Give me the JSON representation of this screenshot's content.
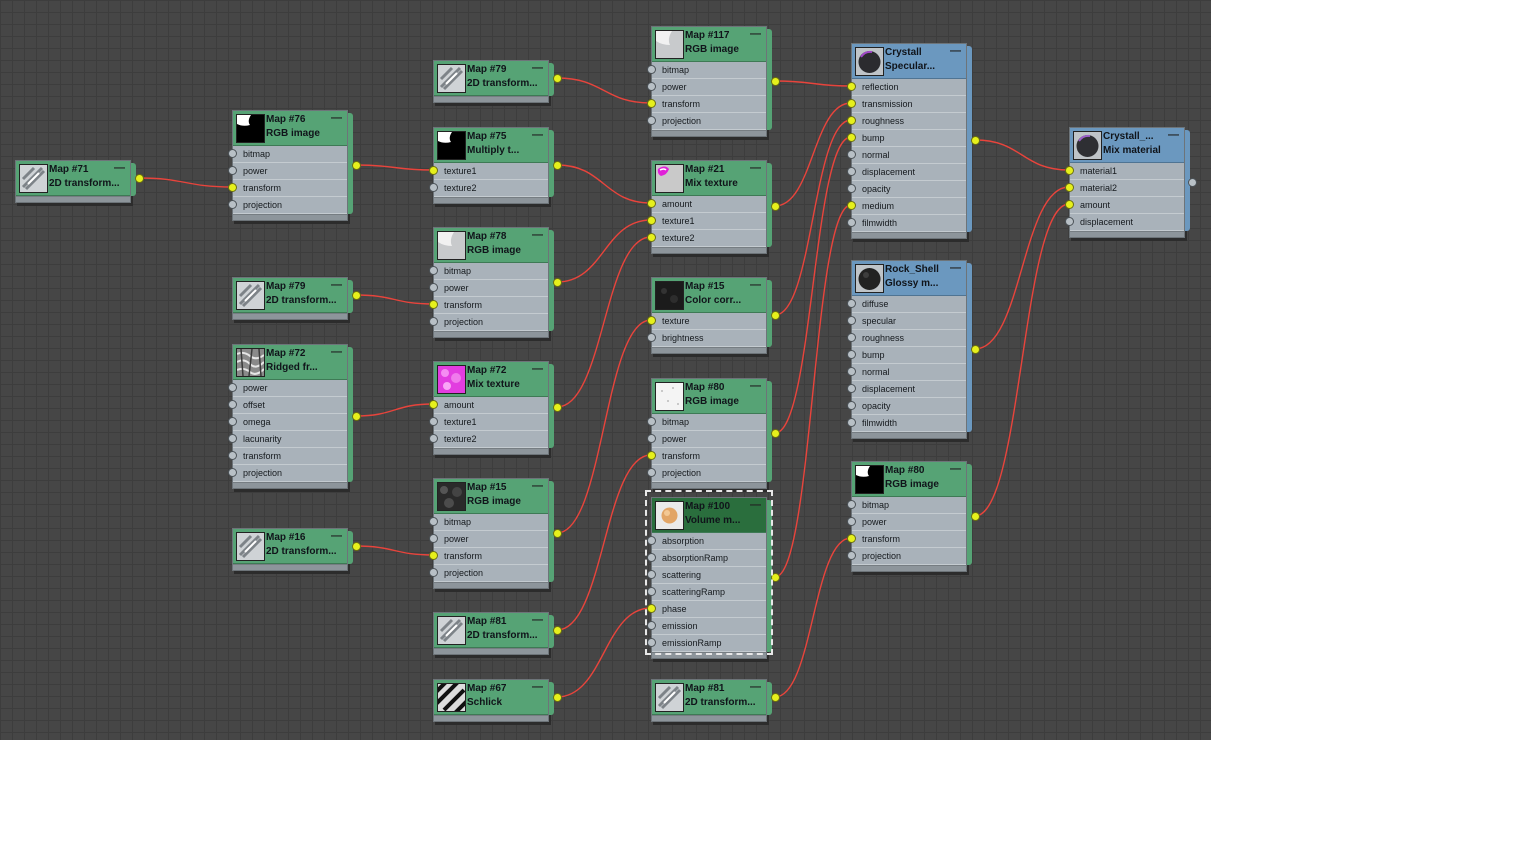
{
  "nodes": [
    {
      "id": "n71",
      "title": "Map #71",
      "subtitle": "2D transform...",
      "thumb": "transform",
      "icon": "transform-thumbnail-icon"
    },
    {
      "id": "n76",
      "title": "Map #76",
      "subtitle": "RGB image",
      "thumb": "black",
      "icon": "rgb-image-thumbnail-icon",
      "ports": [
        {
          "label": "bitmap",
          "on": false
        },
        {
          "label": "power",
          "on": false
        },
        {
          "label": "transform",
          "on": true
        },
        {
          "label": "projection",
          "on": false
        }
      ]
    },
    {
      "id": "n79a",
      "title": "Map #79",
      "subtitle": "2D transform...",
      "thumb": "transform",
      "icon": "transform-thumbnail-icon"
    },
    {
      "id": "n75",
      "title": "Map #75",
      "subtitle": "Multiply  t...",
      "thumb": "black",
      "icon": "multiply-texture-thumbnail-icon",
      "ports": [
        {
          "label": "texture1",
          "on": true
        },
        {
          "label": "texture2",
          "on": false
        }
      ]
    },
    {
      "id": "n117",
      "title": "Map #117",
      "subtitle": "RGB image",
      "thumb": "light",
      "icon": "rgb-image-thumbnail-icon",
      "ports": [
        {
          "label": "bitmap",
          "on": false
        },
        {
          "label": "power",
          "on": false
        },
        {
          "label": "transform",
          "on": true
        },
        {
          "label": "projection",
          "on": false
        }
      ]
    },
    {
      "id": "n21",
      "title": "Map #21",
      "subtitle": "Mix texture",
      "thumb": "magentablob",
      "icon": "mix-texture-thumbnail-icon",
      "ports": [
        {
          "label": "amount",
          "on": true
        },
        {
          "label": "texture1",
          "on": true
        },
        {
          "label": "texture2",
          "on": true
        }
      ]
    },
    {
      "id": "n78",
      "title": "Map #78",
      "subtitle": "RGB image",
      "thumb": "light",
      "icon": "rgb-image-thumbnail-icon",
      "ports": [
        {
          "label": "bitmap",
          "on": false
        },
        {
          "label": "power",
          "on": false
        },
        {
          "label": "transform",
          "on": true
        },
        {
          "label": "projection",
          "on": false
        }
      ]
    },
    {
      "id": "n79b",
      "title": "Map #79",
      "subtitle": "2D transform...",
      "thumb": "transform",
      "icon": "transform-thumbnail-icon"
    },
    {
      "id": "n15a",
      "title": "Map #15",
      "subtitle": "Color  corr...",
      "thumb": "dark",
      "icon": "color-correction-thumbnail-icon",
      "ports": [
        {
          "label": "texture",
          "on": true
        },
        {
          "label": "brightness",
          "on": false
        }
      ]
    },
    {
      "id": "n72a",
      "title": "Map #72",
      "subtitle": "Ridged fr...",
      "thumb": "noise",
      "icon": "ridged-fractal-thumbnail-icon",
      "ports": [
        {
          "label": "power",
          "on": false
        },
        {
          "label": "offset",
          "on": false
        },
        {
          "label": "omega",
          "on": false
        },
        {
          "label": "lacunarity",
          "on": false
        },
        {
          "label": "transform",
          "on": false
        },
        {
          "label": "projection",
          "on": false
        }
      ]
    },
    {
      "id": "n72b",
      "title": "Map #72",
      "subtitle": "Mix texture",
      "thumb": "magenta",
      "icon": "mix-texture-thumbnail-icon",
      "ports": [
        {
          "label": "amount",
          "on": true
        },
        {
          "label": "texture1",
          "on": false
        },
        {
          "label": "texture2",
          "on": false
        }
      ]
    },
    {
      "id": "n80a",
      "title": "Map #80",
      "subtitle": "RGB image",
      "thumb": "white",
      "icon": "rgb-image-thumbnail-icon",
      "ports": [
        {
          "label": "bitmap",
          "on": false
        },
        {
          "label": "power",
          "on": false
        },
        {
          "label": "transform",
          "on": true
        },
        {
          "label": "projection",
          "on": false
        }
      ]
    },
    {
      "id": "n15b",
      "title": "Map #15",
      "subtitle": "RGB image",
      "thumb": "darknoise",
      "icon": "rgb-image-thumbnail-icon",
      "ports": [
        {
          "label": "bitmap",
          "on": false
        },
        {
          "label": "power",
          "on": false
        },
        {
          "label": "transform",
          "on": true
        },
        {
          "label": "projection",
          "on": false
        }
      ]
    },
    {
      "id": "n16",
      "title": "Map #16",
      "subtitle": "2D transform...",
      "thumb": "transform",
      "icon": "transform-thumbnail-icon"
    },
    {
      "id": "n100",
      "title": "Map #100",
      "subtitle": "Volume  m...",
      "thumb": "orange",
      "icon": "volume-material-thumbnail-icon",
      "ports": [
        {
          "label": "absorption",
          "on": false
        },
        {
          "label": "absorptionRamp",
          "on": false
        },
        {
          "label": "scattering",
          "on": false
        },
        {
          "label": "scatteringRamp",
          "on": false
        },
        {
          "label": "phase",
          "on": true
        },
        {
          "label": "emission",
          "on": false
        },
        {
          "label": "emissionRamp",
          "on": false
        }
      ]
    },
    {
      "id": "n81a",
      "title": "Map #81",
      "subtitle": "2D transform...",
      "thumb": "transform",
      "icon": "transform-thumbnail-icon"
    },
    {
      "id": "n67",
      "title": "Map #67",
      "subtitle": "Schlick",
      "thumb": "stripes",
      "icon": "schlick-thumbnail-icon"
    },
    {
      "id": "n81b",
      "title": "Map #81",
      "subtitle": "2D transform...",
      "thumb": "transform",
      "icon": "transform-thumbnail-icon"
    },
    {
      "id": "crys",
      "title": "Crystall",
      "subtitle": "Specular...",
      "thumb": "sphere",
      "icon": "specular-material-thumbnail-icon",
      "ports": [
        {
          "label": "reflection",
          "on": true
        },
        {
          "label": "transmission",
          "on": true
        },
        {
          "label": "roughness",
          "on": true
        },
        {
          "label": "bump",
          "on": true
        },
        {
          "label": "normal",
          "on": false
        },
        {
          "label": "displacement",
          "on": false
        },
        {
          "label": "opacity",
          "on": false
        },
        {
          "label": "medium",
          "on": true
        },
        {
          "label": "filmwidth",
          "on": false
        }
      ]
    },
    {
      "id": "rock",
      "title": "Rock_Shell",
      "subtitle": "Glossy  m...",
      "thumb": "darksphere",
      "icon": "glossy-material-thumbnail-icon",
      "ports": [
        {
          "label": "diffuse",
          "on": false
        },
        {
          "label": "specular",
          "on": false
        },
        {
          "label": "roughness",
          "on": false
        },
        {
          "label": "bump",
          "on": false
        },
        {
          "label": "normal",
          "on": false
        },
        {
          "label": "displacement",
          "on": false
        },
        {
          "label": "opacity",
          "on": false
        },
        {
          "label": "filmwidth",
          "on": false
        }
      ]
    },
    {
      "id": "n80b",
      "title": "Map #80",
      "subtitle": "RGB image",
      "thumb": "redblack",
      "icon": "rgb-image-thumbnail-icon",
      "ports": [
        {
          "label": "bitmap",
          "on": false
        },
        {
          "label": "power",
          "on": false
        },
        {
          "label": "transform",
          "on": true
        },
        {
          "label": "projection",
          "on": false
        }
      ]
    },
    {
      "id": "mix",
      "title": "Crystall_...",
      "subtitle": "Mix material",
      "thumb": "sphere2",
      "icon": "mix-material-thumbnail-icon",
      "ports": [
        {
          "label": "material1",
          "on": true
        },
        {
          "label": "material2",
          "on": true
        },
        {
          "label": "amount",
          "on": true
        },
        {
          "label": "displacement",
          "on": false
        }
      ]
    }
  ],
  "minimize_glyph": "—",
  "colors": {
    "canvas": "#464646",
    "map_header": "#56a375",
    "material_header": "#6b98bf",
    "selected_header": "#2a6e3d",
    "wire": "#e8443c",
    "socket_on": "#e6f01c",
    "socket_off": "#b8c0c6",
    "node_body": "#a9b2ba"
  }
}
